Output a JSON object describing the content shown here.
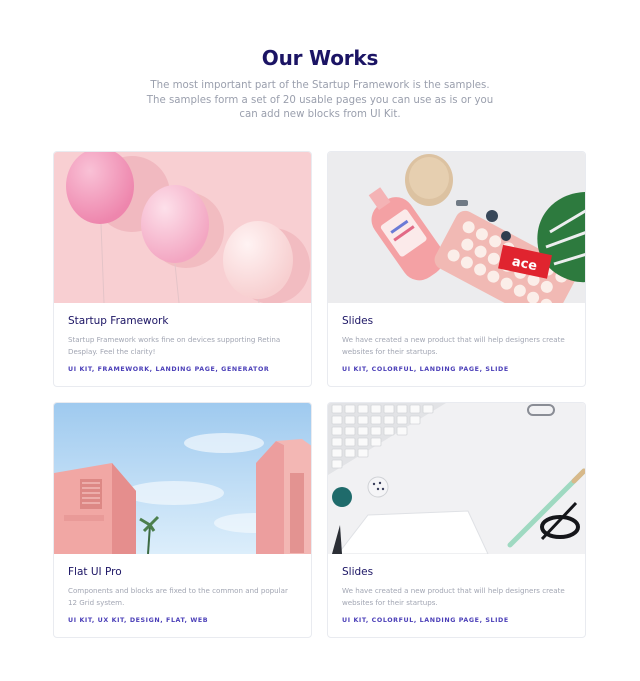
{
  "section": {
    "title": "Our Works",
    "subtitle": "The most important part of the Startup Framework is the samples. The samples form a set of 20 usable pages you can use as is or you can add new blocks from UI Kit."
  },
  "cards": [
    {
      "image": "pink-balloons-image",
      "title": "Startup Framework",
      "description": "Startup Framework works fine on devices supporting Retina Desplay. Feel the clarity!",
      "tags": "UI KIT, FRAMEWORK, LANDING PAGE, GENERATOR"
    },
    {
      "image": "bottle-keyboard-flatlay-image",
      "title": "Slides",
      "description": "We have created a new product that will help designers create websites for their startups.",
      "tags": "UI KIT, COLORFUL, LANDING PAGE, SLIDE",
      "image_text": "ace"
    },
    {
      "image": "pink-building-sky-image",
      "title": "Flat UI Pro",
      "description": "Components and blocks are fixed to the common and popular 12 Grid system.",
      "tags": "UI KIT, UX KIT, DESIGN, FLAT, WEB"
    },
    {
      "image": "keyboard-notebook-desk-image",
      "title": "Slides",
      "description": "We have created a new product that will help designers create websites for their startups.",
      "tags": "UI KIT, COLORFUL, LANDING PAGE, SLIDE"
    }
  ],
  "colors": {
    "heading": "#1b1464",
    "body_text": "#9a9fad",
    "tag_accent": "#4b3fb8",
    "card_border": "#e9ebf0"
  }
}
